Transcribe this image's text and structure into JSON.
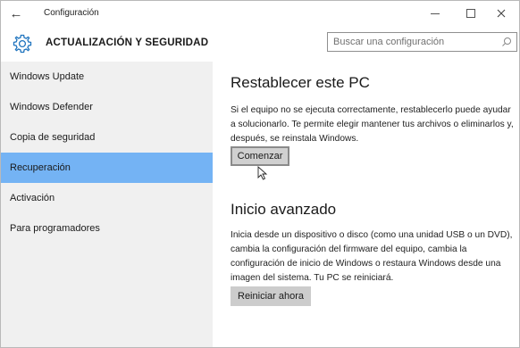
{
  "window": {
    "title": "Configuración",
    "back_icon": "←"
  },
  "header": {
    "title": "ACTUALIZACIÓN Y SEGURIDAD",
    "search_placeholder": "Buscar una configuración"
  },
  "sidebar": {
    "items": [
      {
        "label": "Windows Update"
      },
      {
        "label": "Windows Defender"
      },
      {
        "label": "Copia de seguridad"
      },
      {
        "label": "Recuperación"
      },
      {
        "label": "Activación"
      },
      {
        "label": "Para programadores"
      }
    ],
    "selected": "Recuperación"
  },
  "main": {
    "reset": {
      "title": "Restablecer este PC",
      "description": "Si el equipo no se ejecuta correctamente, restablecerlo puede ayudar a solucionarlo. Te permite elegir mantener tus archivos o eliminarlos y, después, se reinstala Windows.",
      "button": "Comenzar"
    },
    "advanced": {
      "title": "Inicio avanzado",
      "description": "Inicia desde un dispositivo o disco (como una unidad USB o un DVD), cambia la configuración del firmware del equipo, cambia la configuración de inicio de Windows o restaura Windows desde una imagen del sistema. Tu PC se reiniciará.",
      "button": "Reiniciar ahora"
    }
  },
  "colors": {
    "selected_nav": "#74b3f4",
    "accent": "#1e73be"
  }
}
